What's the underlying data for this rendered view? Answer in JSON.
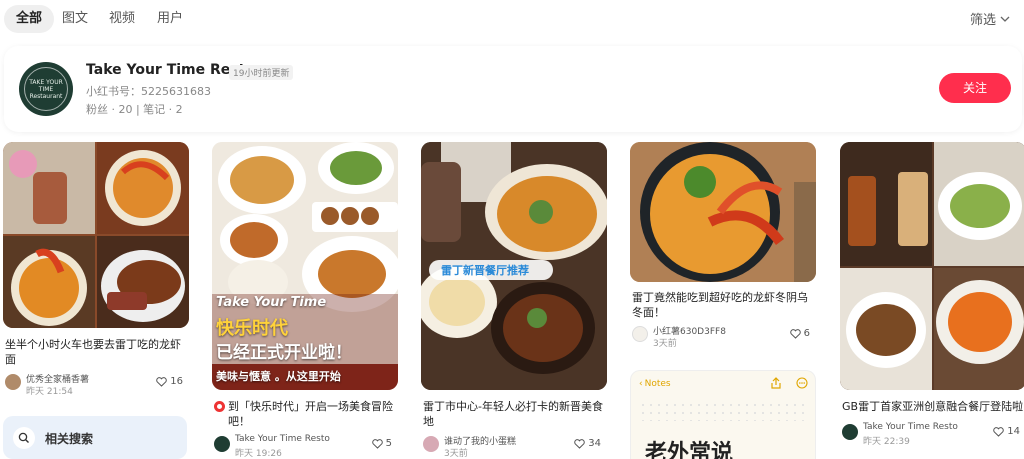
{
  "tabs": [
    "全部",
    "图文",
    "视频",
    "用户"
  ],
  "filter_label": "筛选",
  "profile": {
    "name": "Take Your Time Resto",
    "updated": "19小时前更新",
    "red_id": "小红书号：5225631683",
    "stats": "粉丝 · 20 | 笔记 · 2",
    "follow_label": "关注",
    "avatar_text": "TAKE YOUR TIME Restaurant"
  },
  "related_search": "相关搜索",
  "cards": [
    {
      "title": "坐半个小时火车也要去雷丁吃的龙虾面",
      "user": "优秀全家桶香薯",
      "time": "昨天 21:54",
      "likes": "16"
    },
    {
      "title": "到「快乐时代」开启一场美食冒险吧！",
      "user": "Take Your Time Resto",
      "time": "昨天 19:26",
      "likes": "5",
      "overlay": {
        "l1": "Take Your Time",
        "l2": "快乐时代",
        "l3": "已经正式开业啦！",
        "l4": "美味与惬意 。从这里开始"
      }
    },
    {
      "title": "雷丁市中心-年轻人必打卡的新晋美食地",
      "user": "谁动了我的小蛋糕",
      "time": "3天前",
      "likes": "34",
      "overlay": {
        "sticker": "雷丁新晋餐厅推荐"
      }
    },
    {
      "title": "雷丁竟然能吃到超好吃的龙虾冬阴乌冬面！",
      "user": "小红薯630D3FF8",
      "time": "3天前",
      "likes": "6"
    },
    {
      "title": "GB雷丁首家亚洲创意融合餐厅登陆啦",
      "user": "Take Your Time Resto",
      "time": "昨天 22:39",
      "likes": "14"
    }
  ],
  "notes_card": {
    "back_label": "Notes",
    "big_text": "老外常说"
  },
  "colors": {
    "accent": "#ff2e4d",
    "related_bg": "#eaf1fa"
  }
}
